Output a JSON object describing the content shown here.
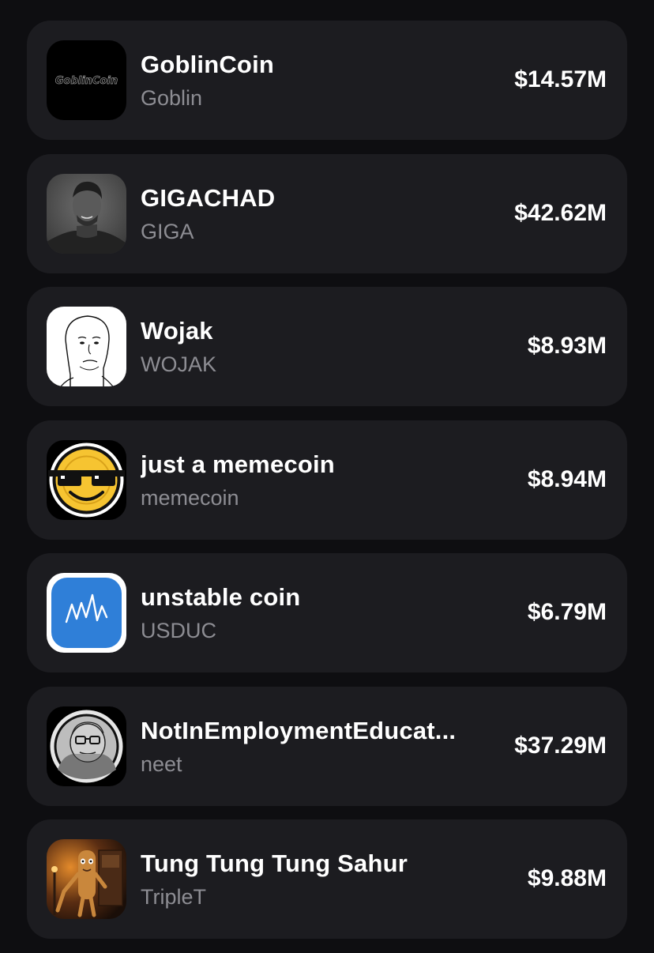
{
  "tokens": [
    {
      "name": "GoblinCoin",
      "ticker": "Goblin",
      "market_cap": "$14.57M",
      "logo_icon": "goblincoin-logo-icon",
      "logo_text": "GoblinCoin"
    },
    {
      "name": "GIGACHAD",
      "ticker": "GIGA",
      "market_cap": "$42.62M",
      "logo_icon": "gigachad-portrait-icon"
    },
    {
      "name": "Wojak",
      "ticker": "WOJAK",
      "market_cap": "$8.93M",
      "logo_icon": "wojak-face-icon"
    },
    {
      "name": "just a memecoin",
      "ticker": "memecoin",
      "market_cap": "$8.94M",
      "logo_icon": "sunglasses-smiley-coin-icon"
    },
    {
      "name": "unstable coin",
      "ticker": "USDUC",
      "market_cap": "$6.79M",
      "logo_icon": "zigzag-chart-icon"
    },
    {
      "name": "NotInEmploymentEducat...",
      "ticker": "neet",
      "market_cap": "$37.29M",
      "logo_icon": "neet-cartoon-face-icon"
    },
    {
      "name": "Tung Tung Tung Sahur",
      "ticker": "TripleT",
      "market_cap": "$9.88M",
      "logo_icon": "tung-sahur-character-icon"
    }
  ],
  "colors": {
    "background": "#0e0e11",
    "card": "#1c1c20",
    "primary_text": "#ffffff",
    "secondary_text": "#8d8d93",
    "usduc_blue": "#2f7fd8",
    "memecoin_yellow": "#f6c431"
  }
}
